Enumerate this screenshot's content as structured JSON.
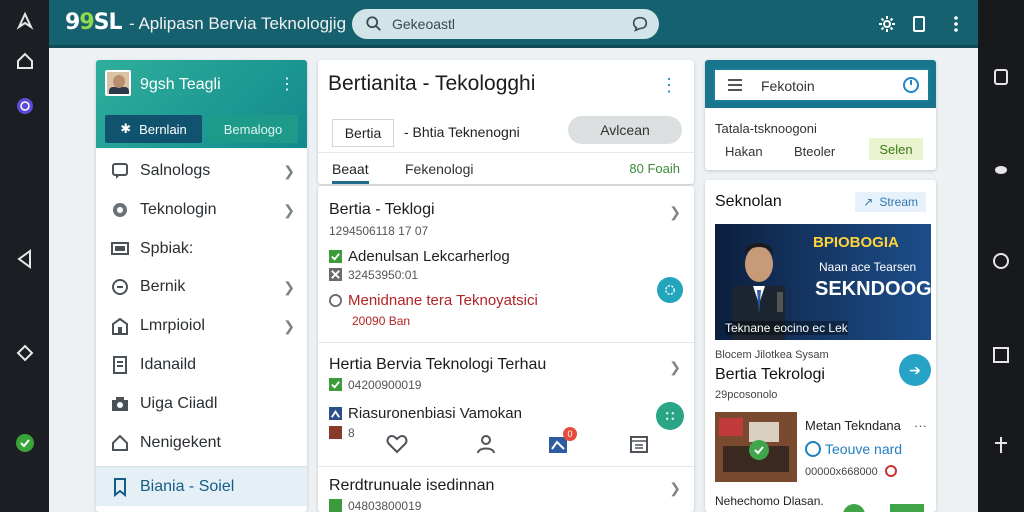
{
  "topbar": {
    "logo_prefix": "9",
    "logo_mid": "9",
    "logo_suffix": "SL",
    "title": "- Aplipasn Bervia Teknologjig Terur",
    "search_value": "Gekeoastl"
  },
  "left_panel": {
    "user_name": "9gsh Teagli",
    "tabs": [
      "Bernlain",
      "Bemalogo"
    ],
    "items": [
      {
        "label": "Salnologs",
        "icon": "chat-bubble-icon",
        "chevron": true
      },
      {
        "label": "Teknologin",
        "icon": "gear-icon",
        "chevron": true
      },
      {
        "label": "Spbiak:",
        "icon": "monitor-icon",
        "chevron": false
      },
      {
        "label": "Bernik",
        "icon": "chat-icon",
        "chevron": true
      },
      {
        "label": "Lmrpioiol",
        "icon": "building-icon",
        "chevron": true
      },
      {
        "label": "Idanaild",
        "icon": "document-icon",
        "chevron": false
      },
      {
        "label": "Uiga Ciiadl",
        "icon": "camera-icon",
        "chevron": false
      },
      {
        "label": "Nenigekent",
        "icon": "home-icon",
        "chevron": false
      },
      {
        "label": "Biania - Soiel",
        "icon": "bookmark-icon",
        "chevron": false
      }
    ]
  },
  "middle": {
    "title": "Bertianita - Tekologghi",
    "chip": "Bertia",
    "subtitle": "- Bhtia Teknenogni",
    "action_button": "Avlcean",
    "tabs": [
      "Beaat",
      "Fekenologi"
    ],
    "tab_right": "80 Foaih",
    "news": [
      {
        "title": "Bertia - Teklogi",
        "lines": [
          "1294506118 17 07",
          "Adenulsan Lekcarherlog",
          "32453950:01",
          "Menidnane tera Teknoyatsici",
          "20090 Ban"
        ]
      },
      {
        "title": "Hertia Bervia Teknologi Terhau",
        "lines": [
          "04200900019",
          "Riasuronenbiasi Vamokan",
          "8"
        ]
      },
      {
        "title": "Rerdtrunuale isedinnan",
        "lines": [
          "04803800019"
        ]
      }
    ],
    "bottom_badge": "0"
  },
  "right_top": {
    "search_label": "Fekotoin",
    "row1": "Tatala-tsknoogoni",
    "row2a": "Hakan",
    "row2b": "Bteoler",
    "button": "Selen"
  },
  "right_main": {
    "title": "Seknolan",
    "stream_chip": "Stream",
    "banner": {
      "line1": "BPIOBOGIA",
      "line2": "Naan ace Tearsen",
      "line3": "SEKNDOOGY",
      "caption": "Teknane eocino ec Lek"
    },
    "meta": "Blocem Jilotkea Sysam",
    "news_title": "Bertia Tekrologi",
    "news_date": "29pcosonolo",
    "item_title": "Metan Tekndana",
    "item_more": "···",
    "item_sub": "Teouve nard",
    "item_date": "00000x668000",
    "item_foot": "Nehechomo Dlasan."
  }
}
